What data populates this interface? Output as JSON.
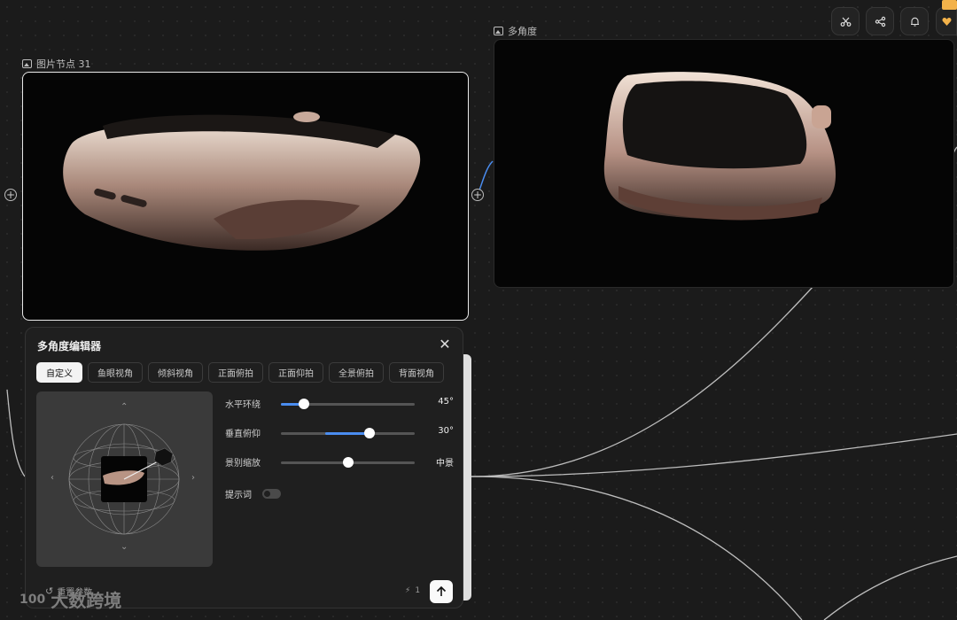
{
  "canvas": {
    "node1": {
      "label": "图片节点 31"
    },
    "node2": {
      "label": "多角度"
    },
    "port_symbol": "+"
  },
  "toolbar": {
    "icons": [
      "scissors-icon",
      "share-icon",
      "bell-icon",
      "badge-icon"
    ]
  },
  "editor": {
    "title": "多角度编辑器",
    "close_symbol": "✕",
    "tabs": [
      "自定义",
      "鱼眼视角",
      "倾斜视角",
      "正面俯拍",
      "正面仰拍",
      "全景俯拍",
      "背面视角"
    ],
    "active_tab": "自定义",
    "viewer_arrows": {
      "up": "⌃",
      "down": "⌄",
      "left": "‹",
      "right": "›"
    },
    "sliders": {
      "horizontal": {
        "label": "水平环绕",
        "value": "45°",
        "level": 0.17
      },
      "vertical": {
        "label": "垂直俯仰",
        "value": "30°",
        "level": 0.66
      },
      "zoom": {
        "label": "景别缩放",
        "value": "中景",
        "level": 0.5
      }
    },
    "prompt_label": "提示词",
    "prompt_enabled": false,
    "reset_label": "重置参数",
    "credits": "1",
    "credits_icon": "⚡"
  },
  "watermark": {
    "logo": "100",
    "text": "大数跨境"
  },
  "colors": {
    "accent": "#4a8df0",
    "badge": "#f3b24a",
    "edge": "#bdbdbd"
  }
}
